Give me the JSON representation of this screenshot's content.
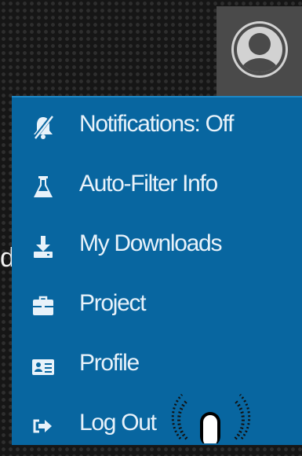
{
  "background_fragment": "d",
  "user_menu": {
    "avatar_icon": "user-avatar-icon",
    "items": [
      {
        "label": "Notifications: Off",
        "icon": "bell-slash-icon"
      },
      {
        "label": "Auto-Filter Info",
        "icon": "flask-icon"
      },
      {
        "label": "My Downloads",
        "icon": "download-icon"
      },
      {
        "label": "Project",
        "icon": "briefcase-icon"
      },
      {
        "label": "Profile",
        "icon": "id-card-icon"
      },
      {
        "label": "Log Out",
        "icon": "sign-out-icon"
      }
    ]
  },
  "colors": {
    "menu_bg": "#0866a0",
    "menu_text": "#e8f2fa",
    "avatar_bg": "#4a4a4a"
  }
}
